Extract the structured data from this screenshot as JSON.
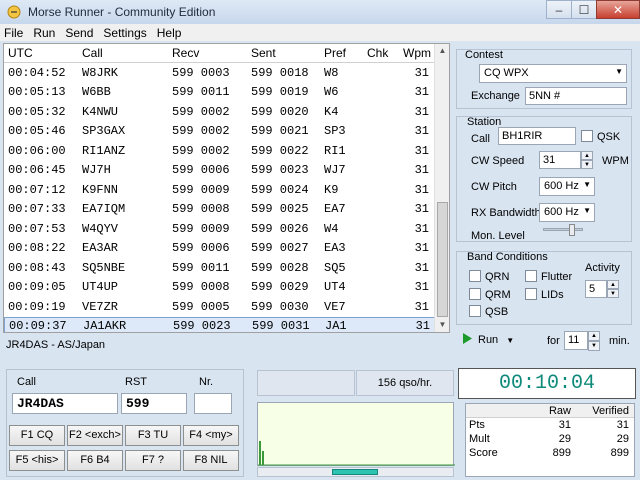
{
  "window": {
    "title": "Morse Runner - Community Edition",
    "min": "–",
    "max": "☐",
    "close": "✕"
  },
  "menu": [
    "File",
    "Run",
    "Send",
    "Settings",
    "Help"
  ],
  "log": {
    "headers": [
      "UTC",
      "Call",
      "Recv",
      "Sent",
      "Pref",
      "Chk",
      "Wpm"
    ],
    "rows": [
      [
        "00:04:52",
        "W8JRK",
        "599 0003",
        "599 0018",
        "W8",
        "",
        "31"
      ],
      [
        "00:05:13",
        "W6BB",
        "599 0011",
        "599 0019",
        "W6",
        "",
        "31"
      ],
      [
        "00:05:32",
        "K4NWU",
        "599 0002",
        "599 0020",
        "K4",
        "",
        "31"
      ],
      [
        "00:05:46",
        "SP3GAX",
        "599 0002",
        "599 0021",
        "SP3",
        "",
        "31"
      ],
      [
        "00:06:00",
        "RI1ANZ",
        "599 0002",
        "599 0022",
        "RI1",
        "",
        "31"
      ],
      [
        "00:06:45",
        "WJ7H",
        "599 0006",
        "599 0023",
        "WJ7",
        "",
        "31"
      ],
      [
        "00:07:12",
        "K9FNN",
        "599 0009",
        "599 0024",
        "K9",
        "",
        "31"
      ],
      [
        "00:07:33",
        "EA7IQM",
        "599 0008",
        "599 0025",
        "EA7",
        "",
        "31"
      ],
      [
        "00:07:53",
        "W4QYV",
        "599 0009",
        "599 0026",
        "W4",
        "",
        "31"
      ],
      [
        "00:08:22",
        "EA3AR",
        "599 0006",
        "599 0027",
        "EA3",
        "",
        "31"
      ],
      [
        "00:08:43",
        "SQ5NBE",
        "599 0011",
        "599 0028",
        "SQ5",
        "",
        "31"
      ],
      [
        "00:09:05",
        "UT4UP",
        "599 0008",
        "599 0029",
        "UT4",
        "",
        "31"
      ],
      [
        "00:09:19",
        "VE7ZR",
        "599 0005",
        "599 0030",
        "VE7",
        "",
        "31"
      ],
      [
        "00:09:37",
        "JA1AKR",
        "599 0023",
        "599 0031",
        "JA1",
        "",
        "31"
      ]
    ],
    "selected_row": 13,
    "status": "JR4DAS - AS/Japan"
  },
  "contest": {
    "group_label": "Contest",
    "selected": "CQ WPX",
    "exchange_label": "Exchange",
    "exchange_value": "5NN #"
  },
  "station": {
    "group_label": "Station",
    "call_label": "Call",
    "call_value": "BH1RIR",
    "qsk_label": "QSK",
    "cw_speed_label": "CW Speed",
    "cw_speed_value": "31",
    "wpm_label": "WPM",
    "cw_pitch_label": "CW Pitch",
    "cw_pitch_value": "600 Hz",
    "rx_bw_label": "RX Bandwidth",
    "rx_bw_value": "600 Hz",
    "mon_level_label": "Mon. Level",
    "mon_level": 0.75
  },
  "band": {
    "group_label": "Band Conditions",
    "qrn": "QRN",
    "qrm": "QRM",
    "qsb": "QSB",
    "flutter": "Flutter",
    "lids": "LIDs",
    "activity_label": "Activity",
    "activity_value": "5"
  },
  "run": {
    "run_label": "Run",
    "for_label": "for",
    "minutes_value": "11",
    "min_label": "min."
  },
  "entry": {
    "call_label": "Call",
    "call_value": "JR4DAS",
    "rst_label": "RST",
    "rst_value": "599",
    "nr_label": "Nr.",
    "nr_value": ""
  },
  "fkeys": [
    "F1 CQ",
    "F2 <exch>",
    "F3 TU",
    "F4 <my>",
    "F5 <his>",
    "F6 B4",
    "F7 ?",
    "F8 NIL"
  ],
  "rate": "156 qso/hr.",
  "timer": "00:10:04",
  "score": {
    "headers": [
      "",
      "Raw",
      "Verified"
    ],
    "rows": [
      [
        "Pts",
        "31",
        "31"
      ],
      [
        "Mult",
        "29",
        "29"
      ],
      [
        "Score",
        "899",
        "899"
      ]
    ]
  },
  "colors": {
    "timer": "#0e8a7a",
    "run_icon": "#1c9a2a",
    "bandmap_bg": "#f7ffe6",
    "bandmap_bar": "#3a9a3a"
  }
}
